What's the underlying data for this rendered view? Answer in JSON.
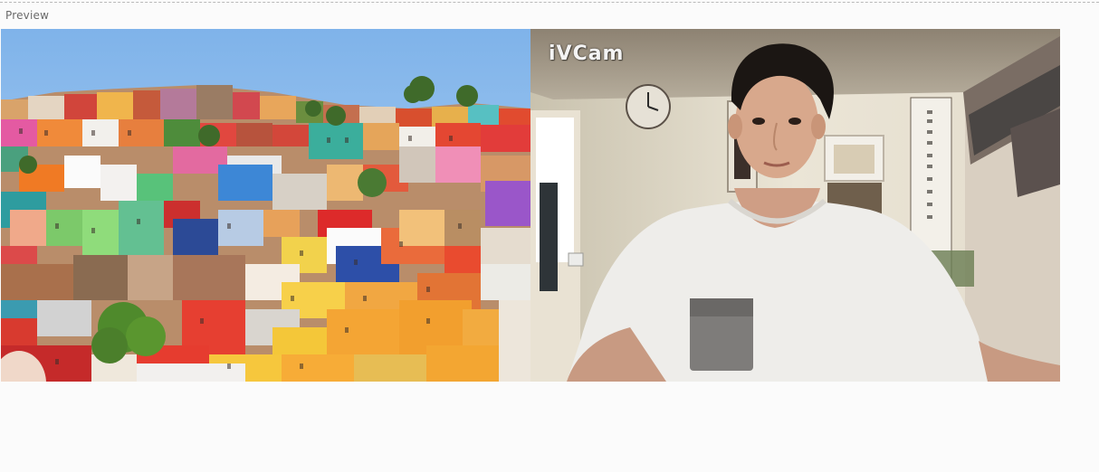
{
  "section": {
    "label": "Preview"
  },
  "left_feed": {
    "description_icon": "city-photo-image"
  },
  "right_feed": {
    "watermark": "iVCam",
    "description_icon": "webcam-video-feed"
  },
  "colors": {
    "background": "#fbfbfb",
    "sky": "#8fbde9",
    "wall": "#e9e3d4"
  }
}
